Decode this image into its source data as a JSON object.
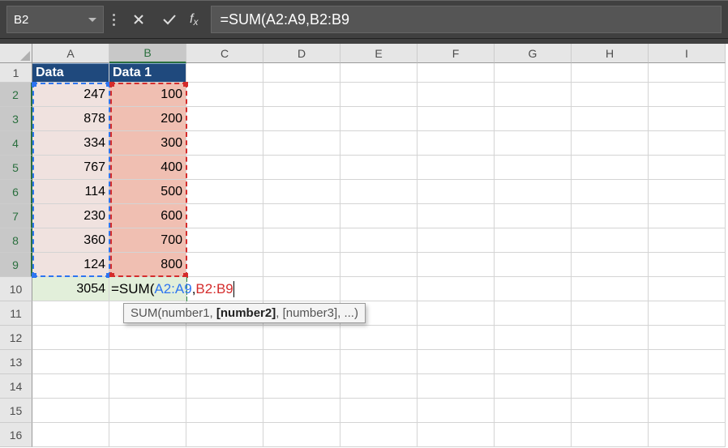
{
  "namebox": "B2",
  "formula_bar": "=SUM(A2:A9,B2:B9",
  "columns": [
    "A",
    "B",
    "C",
    "D",
    "E",
    "F",
    "G",
    "H",
    "I"
  ],
  "selected_col_idx": 1,
  "rows": [
    "1",
    "2",
    "3",
    "4",
    "5",
    "6",
    "7",
    "8",
    "9",
    "10",
    "11",
    "12",
    "13",
    "14",
    "15",
    "16"
  ],
  "selected_row_from": 1,
  "selected_row_to": 8,
  "header_a": "Data",
  "header_b": "Data 1",
  "col_a": [
    "247",
    "878",
    "334",
    "767",
    "114",
    "230",
    "360",
    "124"
  ],
  "col_b": [
    "100",
    "200",
    "300",
    "400",
    "500",
    "600",
    "700",
    "800"
  ],
  "a10": "3054",
  "b10_formula_prefix": "=SUM(",
  "b10_formula_ref1": "A2:A9",
  "b10_formula_sep": ",",
  "b10_formula_ref2": "B2:B9",
  "tooltip": {
    "fn": "SUM",
    "sig_pre": "(number1, ",
    "sig_bold": "[number2]",
    "sig_post": ", [number3], ...)"
  }
}
